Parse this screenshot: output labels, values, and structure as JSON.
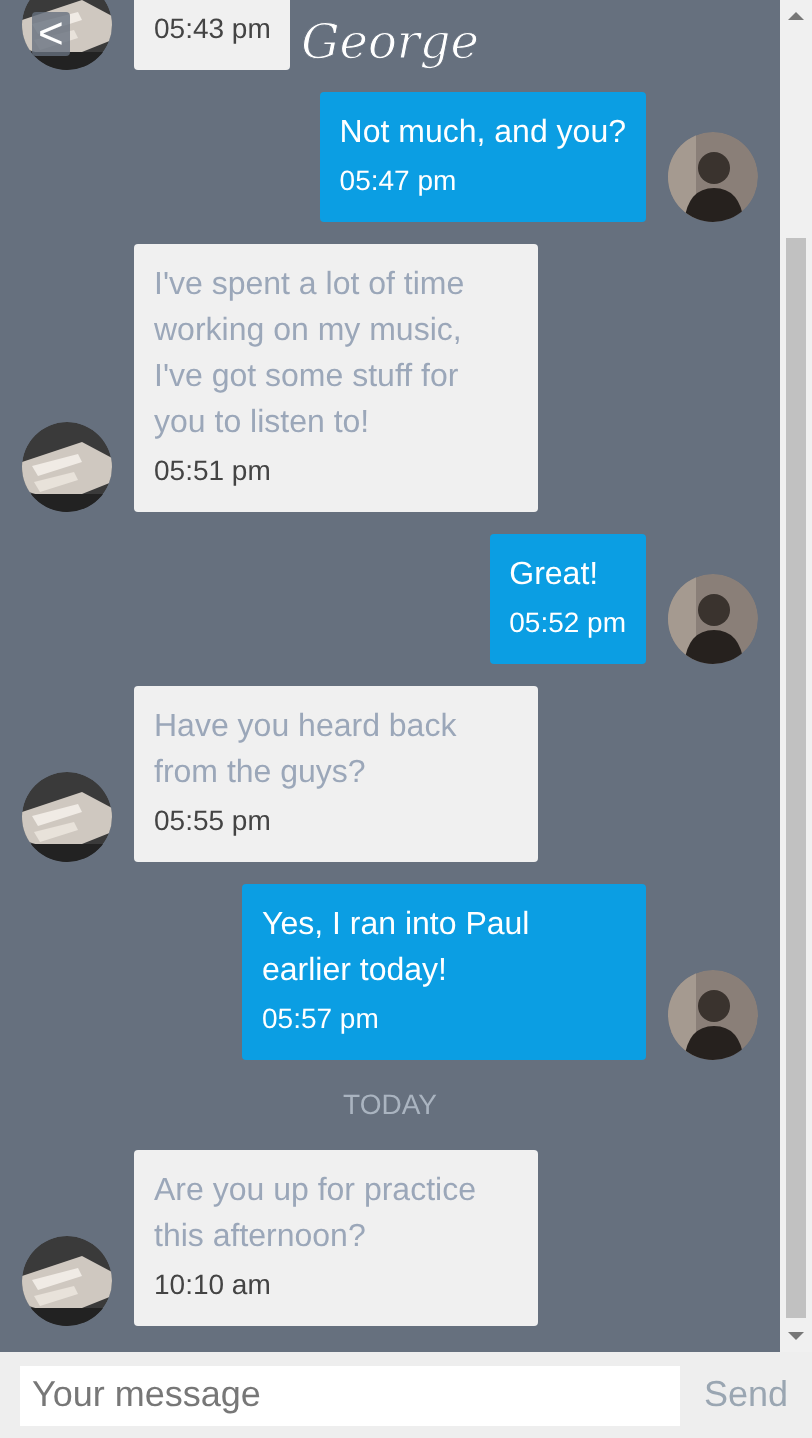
{
  "header": {
    "back": "<",
    "title": "George"
  },
  "messages": [
    {
      "kind": "received",
      "time": "05:43 pm"
    },
    {
      "kind": "sent",
      "text": "Not much, and you?",
      "time": "05:47 pm"
    },
    {
      "kind": "received",
      "text": "I've spent a lot of time working on my music, I've got some stuff for you to listen to!",
      "time": "05:51 pm"
    },
    {
      "kind": "sent",
      "text": "Great!",
      "time": "05:52 pm"
    },
    {
      "kind": "received",
      "text": "Have you heard back from the guys?",
      "time": "05:55 pm"
    },
    {
      "kind": "sent",
      "text": "Yes, I ran into Paul earlier today!",
      "time": "05:57 pm"
    },
    {
      "kind": "separator",
      "text": "TODAY"
    },
    {
      "kind": "received",
      "text": "Are you up for practice this afternoon?",
      "time": "10:10 am"
    }
  ],
  "composer": {
    "placeholder": "Your message",
    "send": "Send"
  }
}
